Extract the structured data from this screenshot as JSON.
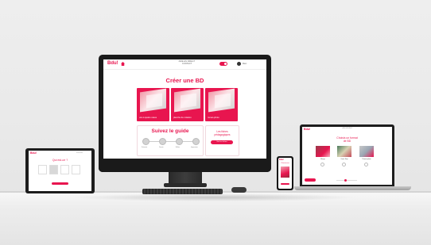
{
  "brand": {
    "logo": "Bdu!",
    "accent": "#e8154f"
  },
  "monitor": {
    "topbar": {
      "center_line1": "AIDE EN DIRECT",
      "center_line2": "CONTACT",
      "toggle_label": "",
      "user": "Marc"
    },
    "title": "Créer une BD",
    "cards": [
      {
        "caption": "une à quatre cases"
      },
      {
        "caption": "planche de création"
      },
      {
        "caption": "roman-photo"
      }
    ],
    "guide": {
      "title": "Suivez le guide",
      "steps": [
        "Scénario",
        "Dessin",
        "Bulles",
        "Impression"
      ]
    },
    "ideas": {
      "title_line1": "Les fiches",
      "title_line2": "pédagogiques",
      "button": "Voir les fiches"
    }
  },
  "tablet": {
    "title": "Qui est-ce ?",
    "corner": "Sommaire"
  },
  "phone": {
    "title": "Choisissez"
  },
  "laptop": {
    "center": "AIDE EN DIRECT",
    "title_line1": "Choisis un format",
    "title_line2": "de BD",
    "formats": [
      "Manga",
      "Comic Strip",
      "Roman-photo"
    ]
  }
}
